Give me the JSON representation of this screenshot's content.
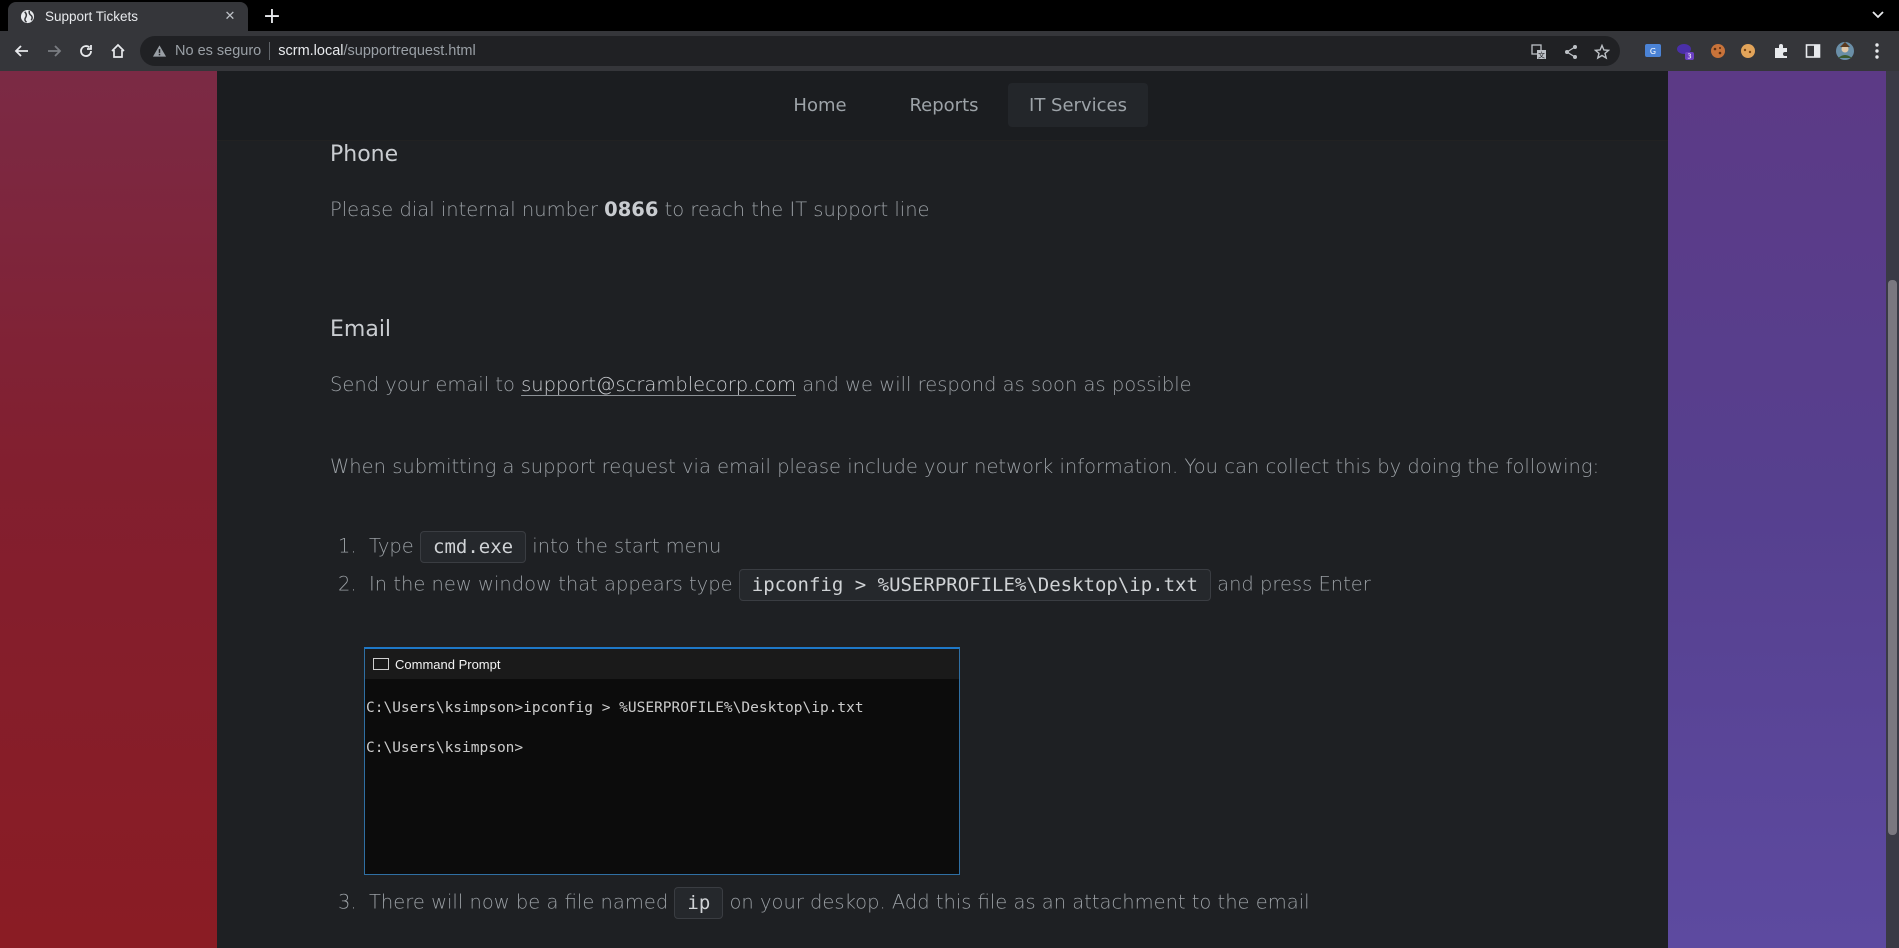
{
  "browser": {
    "tab_title": "Support Tickets",
    "security_label": "No es seguro",
    "url_host": "scrm.local",
    "url_path": "/supportrequest.html",
    "extension_badge": "3"
  },
  "nav": {
    "items": [
      {
        "label": "Home"
      },
      {
        "label": "Reports"
      },
      {
        "label": "IT Services"
      }
    ]
  },
  "phone": {
    "heading": "Phone",
    "text_before": "Please dial internal number ",
    "number": "0866",
    "text_after": " to reach the IT support line"
  },
  "email": {
    "heading": "Email",
    "text_before": "Send your email to ",
    "address": "support@scramblecorp.com",
    "text_after": " and we will respond as soon as possible",
    "instructions": "When submitting a support request via email please include your network information. You can collect this by doing the following:"
  },
  "steps": [
    {
      "num": "1.",
      "before": "Type ",
      "code": "cmd.exe",
      "after": " into the start menu"
    },
    {
      "num": "2.",
      "before": "In the new window that appears type ",
      "code": "ipconfig > %USERPROFILE%\\Desktop\\ip.txt",
      "after": " and press Enter"
    },
    {
      "num": "3.",
      "before": "There will now be a file named ",
      "code": "ip",
      "after": " on your deskop. Add this file as an attachment to the email"
    }
  ],
  "terminal": {
    "title": "Command Prompt",
    "line1": "C:\\Users\\ksimpson>ipconfig > %USERPROFILE%\\Desktop\\ip.txt",
    "line2": "C:\\Users\\ksimpson>"
  }
}
